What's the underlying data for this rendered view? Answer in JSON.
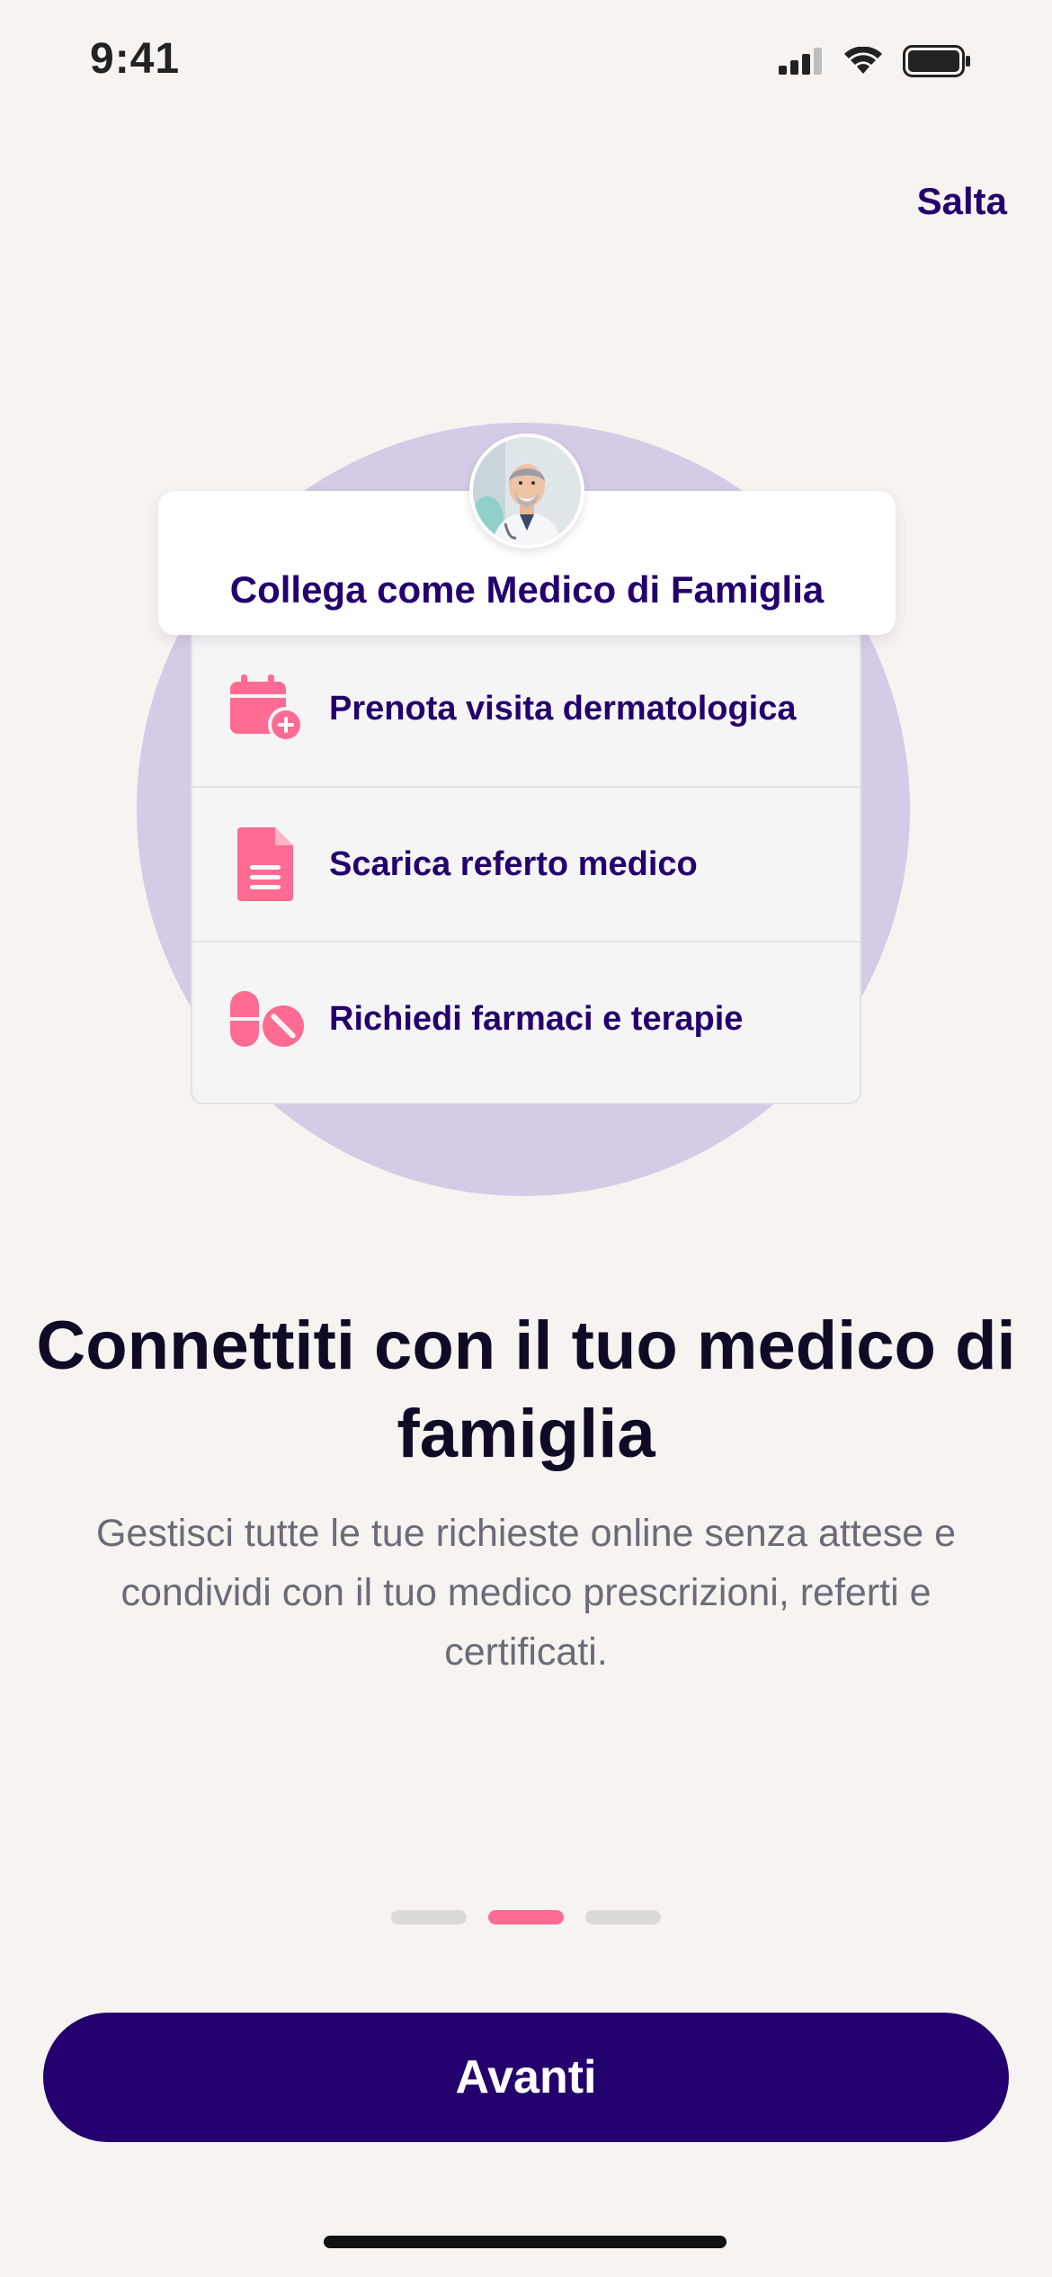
{
  "status_bar": {
    "time": "9:41"
  },
  "header": {
    "skip_label": "Salta"
  },
  "illustration": {
    "card_title": "Collega come Medico di Famiglia",
    "items": [
      {
        "label": "Prenota visita dermatologica",
        "icon": "calendar-add-icon"
      },
      {
        "label": "Scarica referto medico",
        "icon": "document-icon"
      },
      {
        "label": "Richiedi farmaci e terapie",
        "icon": "pill-icon"
      }
    ]
  },
  "content": {
    "title": "Connettiti con il tuo medico di famiglia",
    "description": "Gestisci tutte le tue richieste online senza attese e condividi con il tuo medico prescrizioni, referti e certificati."
  },
  "pager": {
    "pages": 3,
    "active_index": 1
  },
  "footer": {
    "primary_button": "Avanti"
  },
  "colors": {
    "background": "#f6f3f0",
    "primary": "#24006e",
    "accent": "#ff6b93",
    "circle": "#d4cbe6",
    "body_text": "#6b6b78"
  }
}
